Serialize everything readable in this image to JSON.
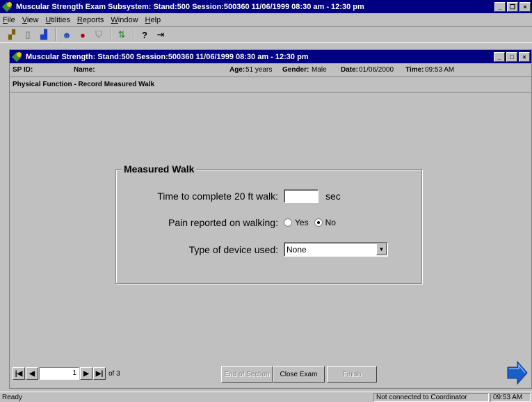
{
  "window": {
    "title": "Muscular Strength Exam Subsystem: Stand:500 Session:500360 11/06/1999 08:30 am - 12:30 pm"
  },
  "menu": [
    "File",
    "View",
    "Utilities",
    "Reports",
    "Window",
    "Help"
  ],
  "toolbar_icons": [
    "open-icon",
    "clipboard-icon",
    "chart-icon",
    "users-icon",
    "stop-icon",
    "filter-icon",
    "sort-icon",
    "help-icon",
    "exit-icon"
  ],
  "child_window": {
    "title": "Muscular Strength: Stand:500 Session:500360 11/06/1999 08:30 am - 12:30 pm"
  },
  "participant": {
    "spid_label": "SP ID:",
    "spid_value": "",
    "name_label": "Name:",
    "name_value": "",
    "age_label": "Age:",
    "age_value": "51 years",
    "gender_label": "Gender:",
    "gender_value": "Male",
    "date_label": "Date:",
    "date_value": "01/06/2000",
    "time_label": "Time:",
    "time_value": "09:53 AM"
  },
  "section": {
    "title": "Physical Function - Record Measured Walk"
  },
  "form": {
    "group_title": "Measured Walk",
    "walk_time_label": "Time to complete 20 ft walk:",
    "walk_time_value": "",
    "walk_time_unit": "sec",
    "pain_label": "Pain reported on walking:",
    "pain_yes": "Yes",
    "pain_no": "No",
    "pain_selected": "No",
    "device_label": "Type of device used:",
    "device_value": "None"
  },
  "navigation": {
    "page_value": "1",
    "page_total": "of 3",
    "end_of_section": "End of Section",
    "close_exam": "Close Exam",
    "finish": "Finish"
  },
  "status": {
    "left": "Ready",
    "connection": "Not connected to Coordinator",
    "clock": "09:53 AM"
  },
  "colors": {
    "title_bar": "#000080",
    "face": "#c0c0c0",
    "next_arrow": "#1a5fc8"
  }
}
